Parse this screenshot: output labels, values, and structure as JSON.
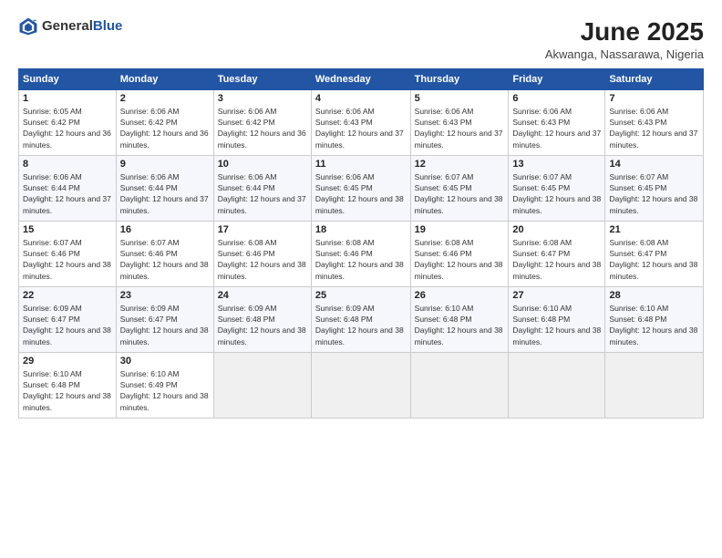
{
  "header": {
    "logo_general": "General",
    "logo_blue": "Blue",
    "title": "June 2025",
    "subtitle": "Akwanga, Nassarawa, Nigeria"
  },
  "columns": [
    "Sunday",
    "Monday",
    "Tuesday",
    "Wednesday",
    "Thursday",
    "Friday",
    "Saturday"
  ],
  "weeks": [
    [
      {
        "day": "1",
        "sunrise": "Sunrise: 6:05 AM",
        "sunset": "Sunset: 6:42 PM",
        "daylight": "Daylight: 12 hours and 36 minutes."
      },
      {
        "day": "2",
        "sunrise": "Sunrise: 6:06 AM",
        "sunset": "Sunset: 6:42 PM",
        "daylight": "Daylight: 12 hours and 36 minutes."
      },
      {
        "day": "3",
        "sunrise": "Sunrise: 6:06 AM",
        "sunset": "Sunset: 6:42 PM",
        "daylight": "Daylight: 12 hours and 36 minutes."
      },
      {
        "day": "4",
        "sunrise": "Sunrise: 6:06 AM",
        "sunset": "Sunset: 6:43 PM",
        "daylight": "Daylight: 12 hours and 37 minutes."
      },
      {
        "day": "5",
        "sunrise": "Sunrise: 6:06 AM",
        "sunset": "Sunset: 6:43 PM",
        "daylight": "Daylight: 12 hours and 37 minutes."
      },
      {
        "day": "6",
        "sunrise": "Sunrise: 6:06 AM",
        "sunset": "Sunset: 6:43 PM",
        "daylight": "Daylight: 12 hours and 37 minutes."
      },
      {
        "day": "7",
        "sunrise": "Sunrise: 6:06 AM",
        "sunset": "Sunset: 6:43 PM",
        "daylight": "Daylight: 12 hours and 37 minutes."
      }
    ],
    [
      {
        "day": "8",
        "sunrise": "Sunrise: 6:06 AM",
        "sunset": "Sunset: 6:44 PM",
        "daylight": "Daylight: 12 hours and 37 minutes."
      },
      {
        "day": "9",
        "sunrise": "Sunrise: 6:06 AM",
        "sunset": "Sunset: 6:44 PM",
        "daylight": "Daylight: 12 hours and 37 minutes."
      },
      {
        "day": "10",
        "sunrise": "Sunrise: 6:06 AM",
        "sunset": "Sunset: 6:44 PM",
        "daylight": "Daylight: 12 hours and 37 minutes."
      },
      {
        "day": "11",
        "sunrise": "Sunrise: 6:06 AM",
        "sunset": "Sunset: 6:45 PM",
        "daylight": "Daylight: 12 hours and 38 minutes."
      },
      {
        "day": "12",
        "sunrise": "Sunrise: 6:07 AM",
        "sunset": "Sunset: 6:45 PM",
        "daylight": "Daylight: 12 hours and 38 minutes."
      },
      {
        "day": "13",
        "sunrise": "Sunrise: 6:07 AM",
        "sunset": "Sunset: 6:45 PM",
        "daylight": "Daylight: 12 hours and 38 minutes."
      },
      {
        "day": "14",
        "sunrise": "Sunrise: 6:07 AM",
        "sunset": "Sunset: 6:45 PM",
        "daylight": "Daylight: 12 hours and 38 minutes."
      }
    ],
    [
      {
        "day": "15",
        "sunrise": "Sunrise: 6:07 AM",
        "sunset": "Sunset: 6:46 PM",
        "daylight": "Daylight: 12 hours and 38 minutes."
      },
      {
        "day": "16",
        "sunrise": "Sunrise: 6:07 AM",
        "sunset": "Sunset: 6:46 PM",
        "daylight": "Daylight: 12 hours and 38 minutes."
      },
      {
        "day": "17",
        "sunrise": "Sunrise: 6:08 AM",
        "sunset": "Sunset: 6:46 PM",
        "daylight": "Daylight: 12 hours and 38 minutes."
      },
      {
        "day": "18",
        "sunrise": "Sunrise: 6:08 AM",
        "sunset": "Sunset: 6:46 PM",
        "daylight": "Daylight: 12 hours and 38 minutes."
      },
      {
        "day": "19",
        "sunrise": "Sunrise: 6:08 AM",
        "sunset": "Sunset: 6:46 PM",
        "daylight": "Daylight: 12 hours and 38 minutes."
      },
      {
        "day": "20",
        "sunrise": "Sunrise: 6:08 AM",
        "sunset": "Sunset: 6:47 PM",
        "daylight": "Daylight: 12 hours and 38 minutes."
      },
      {
        "day": "21",
        "sunrise": "Sunrise: 6:08 AM",
        "sunset": "Sunset: 6:47 PM",
        "daylight": "Daylight: 12 hours and 38 minutes."
      }
    ],
    [
      {
        "day": "22",
        "sunrise": "Sunrise: 6:09 AM",
        "sunset": "Sunset: 6:47 PM",
        "daylight": "Daylight: 12 hours and 38 minutes."
      },
      {
        "day": "23",
        "sunrise": "Sunrise: 6:09 AM",
        "sunset": "Sunset: 6:47 PM",
        "daylight": "Daylight: 12 hours and 38 minutes."
      },
      {
        "day": "24",
        "sunrise": "Sunrise: 6:09 AM",
        "sunset": "Sunset: 6:48 PM",
        "daylight": "Daylight: 12 hours and 38 minutes."
      },
      {
        "day": "25",
        "sunrise": "Sunrise: 6:09 AM",
        "sunset": "Sunset: 6:48 PM",
        "daylight": "Daylight: 12 hours and 38 minutes."
      },
      {
        "day": "26",
        "sunrise": "Sunrise: 6:10 AM",
        "sunset": "Sunset: 6:48 PM",
        "daylight": "Daylight: 12 hours and 38 minutes."
      },
      {
        "day": "27",
        "sunrise": "Sunrise: 6:10 AM",
        "sunset": "Sunset: 6:48 PM",
        "daylight": "Daylight: 12 hours and 38 minutes."
      },
      {
        "day": "28",
        "sunrise": "Sunrise: 6:10 AM",
        "sunset": "Sunset: 6:48 PM",
        "daylight": "Daylight: 12 hours and 38 minutes."
      }
    ],
    [
      {
        "day": "29",
        "sunrise": "Sunrise: 6:10 AM",
        "sunset": "Sunset: 6:48 PM",
        "daylight": "Daylight: 12 hours and 38 minutes."
      },
      {
        "day": "30",
        "sunrise": "Sunrise: 6:10 AM",
        "sunset": "Sunset: 6:49 PM",
        "daylight": "Daylight: 12 hours and 38 minutes."
      },
      null,
      null,
      null,
      null,
      null
    ]
  ]
}
